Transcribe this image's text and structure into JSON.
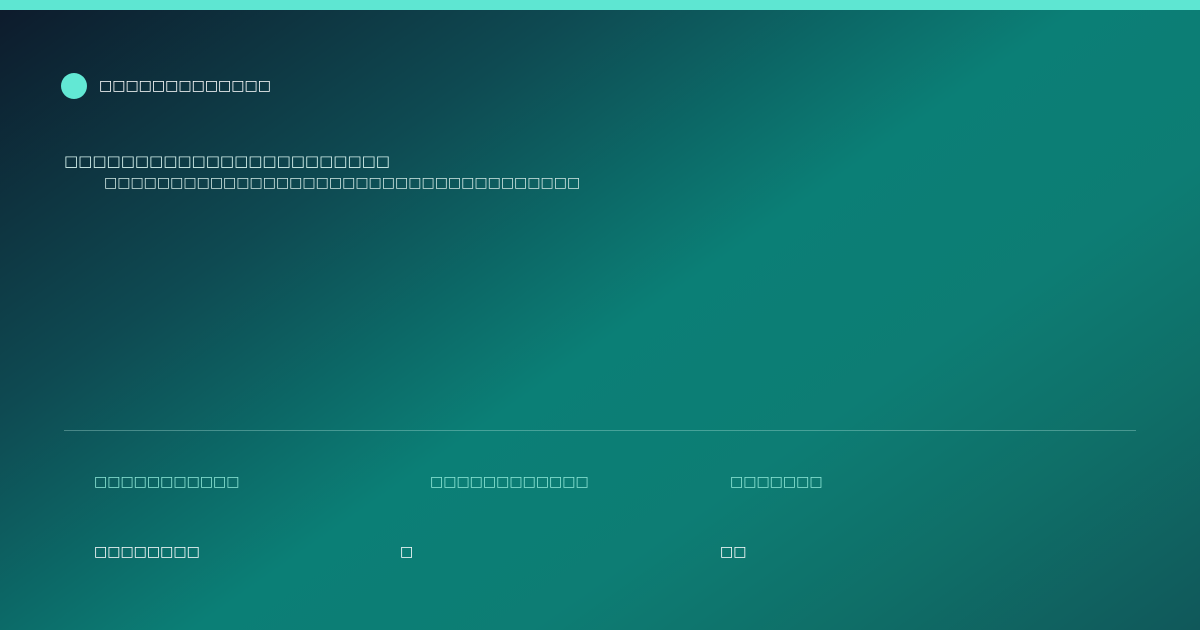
{
  "header": {
    "brand_name": "□□□□□□□□□□□□□"
  },
  "hero": {
    "headline": "□□□□□□□□□□□□□□□□□□□□□□□",
    "subline": "□□□□□□□□□□□□□□□□□□□□□□□□□□□□□□□□□□□□"
  },
  "stats": [
    {
      "label": "□□□□□□□□□□□",
      "value": "□□□□□□□□"
    },
    {
      "label": "□□□□□□□□□□□□",
      "value": "□"
    },
    {
      "label": "□□□□□□□",
      "value": "□□"
    }
  ],
  "colors": {
    "accent": "#5ee6d2",
    "stat_label": "#8de6d6",
    "text": "#ffffff"
  }
}
